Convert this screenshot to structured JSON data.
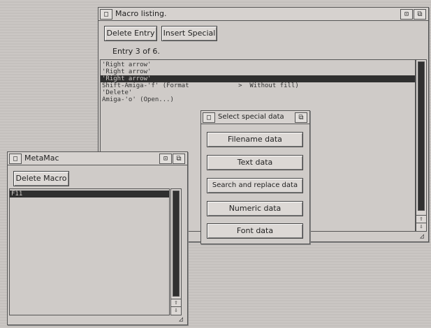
{
  "macro_listing": {
    "close_glyph": "□",
    "title": "Macro listing.",
    "depth_glyph": "⧉",
    "zoom_glyph": "⊡",
    "delete_entry_label": "Delete Entry",
    "insert_special_label": "Insert Special",
    "entry_status": "Entry 3 of 6.",
    "entries": [
      "'Right arrow'",
      "'Right arrow'",
      "'Right arrow'",
      "Shift-Amiga-'f' (Format             >  Without fill)",
      "'Delete'",
      "Amiga-'o' (Open...)"
    ],
    "selected_index": 2,
    "scroll_up_glyph": "⇧",
    "scroll_down_glyph": "⇩",
    "sizer_glyph": "◿"
  },
  "special_data": {
    "close_glyph": "□",
    "title": "Select special data",
    "depth_glyph": "⧉",
    "options": [
      "Filename data",
      "Text data",
      "Search and replace data",
      "Numeric data",
      "Font data"
    ]
  },
  "metamac": {
    "close_glyph": "□",
    "title": "MetaMac",
    "zoom_glyph": "⊡",
    "depth_glyph": "⧉",
    "delete_macro_label": "Delete Macro",
    "items": [
      "F11"
    ],
    "selected_index": 0,
    "scroll_up_glyph": "⇧",
    "scroll_down_glyph": "⇩",
    "sizer_glyph": "◿"
  }
}
